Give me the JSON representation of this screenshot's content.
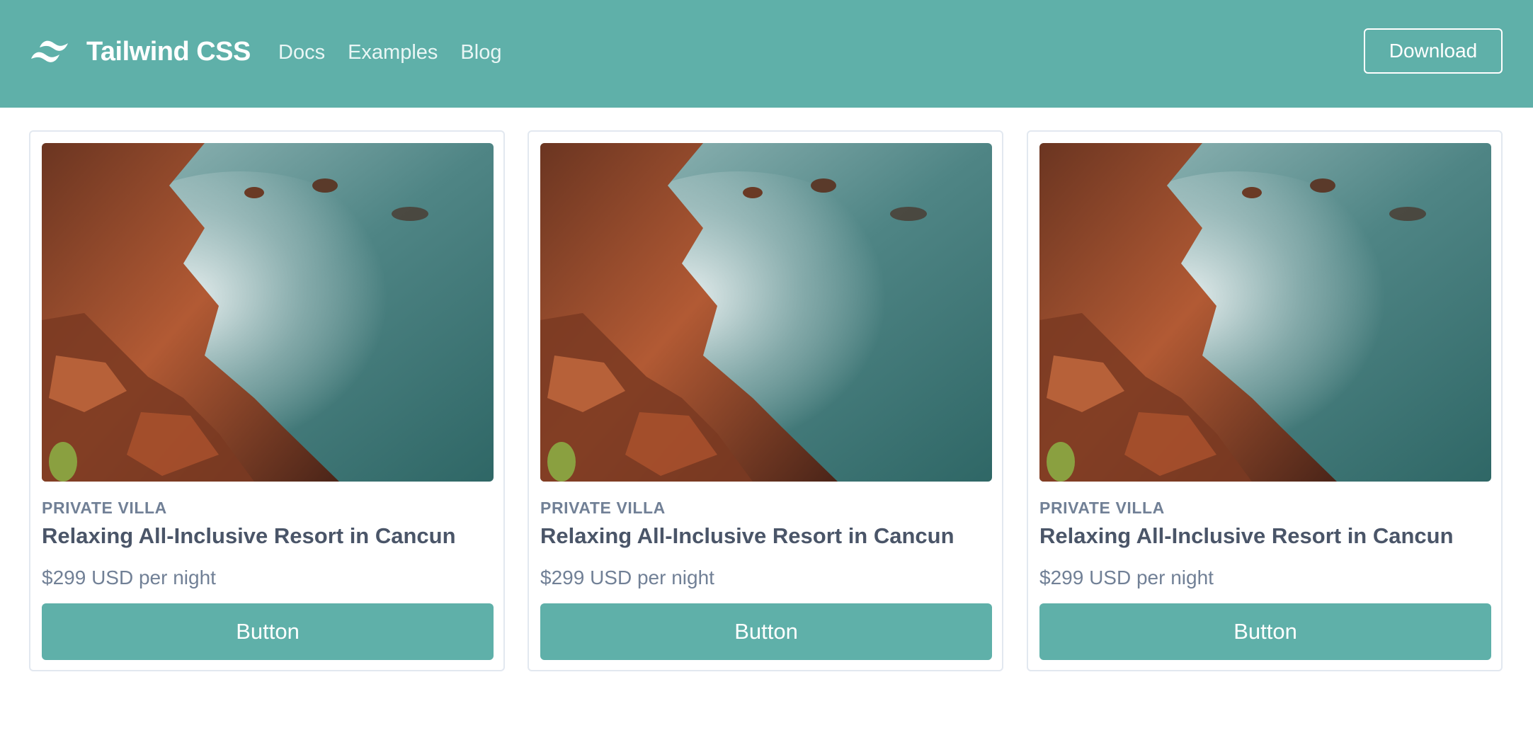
{
  "navbar": {
    "brand": "Tailwind CSS",
    "logo_icon": "tailwind-wave-icon",
    "links": [
      "Docs",
      "Examples",
      "Blog"
    ],
    "download_label": "Download"
  },
  "cards": [
    {
      "image": "coastal-rocks-image",
      "eyebrow": "PRIVATE VILLA",
      "title": "Relaxing All-Inclusive Resort in Cancun",
      "price": "$299 USD per night",
      "button_label": "Button"
    },
    {
      "image": "coastal-rocks-image",
      "eyebrow": "PRIVATE VILLA",
      "title": "Relaxing All-Inclusive Resort in Cancun",
      "price": "$299 USD per night",
      "button_label": "Button"
    },
    {
      "image": "coastal-rocks-image",
      "eyebrow": "PRIVATE VILLA",
      "title": "Relaxing All-Inclusive Resort in Cancun",
      "price": "$299 USD per night",
      "button_label": "Button"
    }
  ],
  "colors": {
    "accent": "#5fb0a9",
    "card_border": "#e2e8f0",
    "eyebrow": "#718096",
    "title": "#4a5568"
  }
}
